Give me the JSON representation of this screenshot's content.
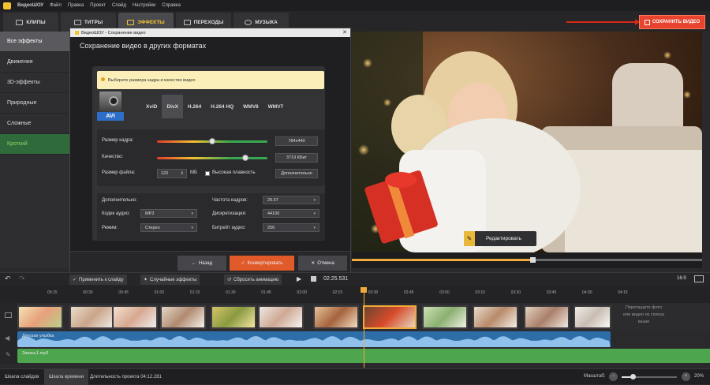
{
  "app": {
    "name": "ВидеоШОУ"
  },
  "menu": [
    "Файл",
    "Правка",
    "Проект",
    "Слайд",
    "Настройки",
    "Справка"
  ],
  "tabs": [
    {
      "label": "КЛИПЫ",
      "icon": "film-icon"
    },
    {
      "label": "ТИТРЫ",
      "icon": "text-icon"
    },
    {
      "label": "ЭФФЕКТЫ",
      "icon": "effects-icon",
      "active": true
    },
    {
      "label": "ПЕРЕХОДЫ",
      "icon": "transition-icon"
    },
    {
      "label": "МУЗЫКА",
      "icon": "music-icon"
    }
  ],
  "save_button": {
    "label": "СОХРАНИТЬ ВИДЕО"
  },
  "sidebar": {
    "items": [
      {
        "label": "Все эффекты",
        "active": true
      },
      {
        "label": "Движения"
      },
      {
        "label": "3D-эффекты"
      },
      {
        "label": "Природные"
      },
      {
        "label": "Сложные"
      },
      {
        "label": "Кроткий"
      }
    ]
  },
  "dialog": {
    "window_title": "ВидеоШОУ - Сохранение видео",
    "heading": "Сохранение видео в других форматах",
    "note": "Выберите размера кадра и качество видео",
    "format_label": "AVI",
    "formats": [
      "XviD",
      "DivX",
      "H.264",
      "H.264 HQ",
      "WMV8",
      "WMV7"
    ],
    "active_format": "DivX",
    "frame_size": {
      "label": "Размер кадра:",
      "value": "784x440",
      "level": 0.5
    },
    "quality": {
      "label": "Качество:",
      "value": "3719 КБит",
      "level": 0.8
    },
    "file_size": {
      "label": "Размер файла:",
      "value": "120",
      "unit": "МБ"
    },
    "smooth_label": "Высокая плавность",
    "advanced_button": "Дополнительно",
    "extra_header": "Дополнительно:",
    "audio_codec": {
      "label": "Кодек аудио:",
      "value": "MP3"
    },
    "mode": {
      "label": "Режим:",
      "value": "Стерео"
    },
    "fps": {
      "label": "Частота кадров:",
      "value": "29.97"
    },
    "sampling": {
      "label": "Дискретизация:",
      "value": "44100"
    },
    "bitrate": {
      "label": "Битрейт аудио:",
      "value": "256"
    },
    "buttons": {
      "back": "Назад",
      "convert": "Конвертировать",
      "cancel": "Отмена"
    }
  },
  "preview": {
    "edit_button": "Редактировать"
  },
  "toolbar": {
    "apply_slide": "Применить к слайду",
    "random_effects": "Случайные эффекты",
    "reset_animation": "Сбросить анимацию",
    "time": "02:25.531",
    "aspect": "16:9"
  },
  "ruler": [
    "00:15",
    "00:30",
    "00:45",
    "01:00",
    "01:15",
    "01:30",
    "01:45",
    "02:00",
    "02:15",
    "02:30",
    "02:45",
    "03:00",
    "03:15",
    "03:30",
    "03:45",
    "04:00",
    "04:15"
  ],
  "timeline": {
    "drag_hint": "Перетащите фото или видео из списка выше",
    "audio1": "Детская улыбка",
    "audio2": "Запись1.mp3"
  },
  "status": {
    "tab_slides": "Шкала слайдов",
    "tab_timeline": "Шкала времени",
    "duration": "Длительность проекта 04:12.281",
    "zoom_label": "Масштаб:",
    "zoom_value": "20%"
  },
  "colors": {
    "accent": "#f2c431",
    "save": "#e8432f",
    "convert": "#e15a2a",
    "audio1": "#2d6da8",
    "audio2": "#4da54d"
  }
}
